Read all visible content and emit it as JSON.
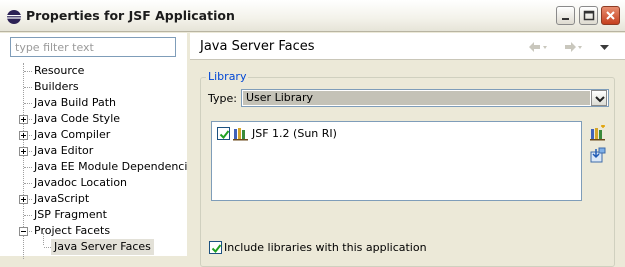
{
  "window": {
    "title": "Properties for JSF Application"
  },
  "filter": {
    "placeholder": "type filter text"
  },
  "tree": {
    "items": [
      {
        "label": "Resource",
        "expandable": false,
        "expanded": false
      },
      {
        "label": "Builders",
        "expandable": false,
        "expanded": false
      },
      {
        "label": "Java Build Path",
        "expandable": false,
        "expanded": false
      },
      {
        "label": "Java Code Style",
        "expandable": true,
        "expanded": false
      },
      {
        "label": "Java Compiler",
        "expandable": true,
        "expanded": false
      },
      {
        "label": "Java Editor",
        "expandable": true,
        "expanded": false
      },
      {
        "label": "Java EE Module Dependencies",
        "expandable": false,
        "expanded": false
      },
      {
        "label": "Javadoc Location",
        "expandable": false,
        "expanded": false
      },
      {
        "label": "JavaScript",
        "expandable": true,
        "expanded": false
      },
      {
        "label": "JSP Fragment",
        "expandable": false,
        "expanded": false
      },
      {
        "label": "Project Facets",
        "expandable": true,
        "expanded": true
      },
      {
        "label": "Java Server Faces",
        "expandable": false,
        "expanded": false,
        "selected": true
      }
    ]
  },
  "page": {
    "title": "Java Server Faces"
  },
  "library": {
    "group_title": "Library",
    "type_label": "Type:",
    "type_value": "User Library",
    "items": [
      {
        "label": "JSF 1.2 (Sun RI)",
        "checked": true
      }
    ],
    "include_label": "Include libraries with this application",
    "include_checked": true
  },
  "colors": {
    "group_title": "#0046d5",
    "selection": "#e3e1d8",
    "close_button": "#c6401f"
  }
}
